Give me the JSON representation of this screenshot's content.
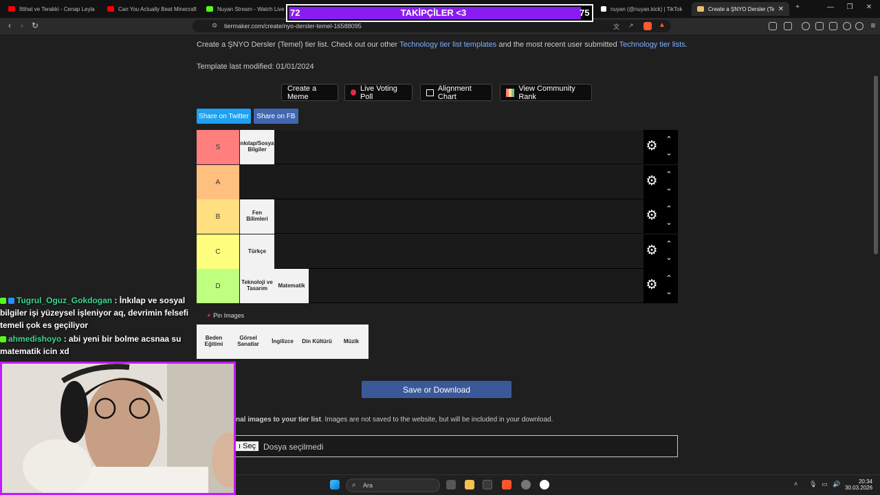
{
  "tabs": [
    {
      "title": "İttihat ve Terakki - Cenap Leyla",
      "color": "#ff0000"
    },
    {
      "title": "Can You Actually Beat Minecraft In",
      "color": "#ff0000"
    },
    {
      "title": "Nuyan Stream - Watch Live on Kick",
      "color": "#53fc18"
    },
    {
      "title": "nuyan (@nuyan.kick) | TikTok",
      "color": "#ffffff"
    },
    {
      "title": "Create a ŞNYO Dersler (Temel)",
      "color": "#e8c06a"
    }
  ],
  "browser": {
    "url": "tiermaker.com/create/nyo-dersler-temel-16588095"
  },
  "page": {
    "intro_prefix": "Create a ŞNYO Dersler (Temel) tier list. Check out our other ",
    "intro_link1": "Technology tier list templates",
    "intro_mid": " and the most recent user submitted ",
    "intro_link2": "Technology tier lists",
    "intro_suffix": ".",
    "modified": "Template last modified: 01/01/2024",
    "buttons": {
      "meme": "Create a Meme",
      "poll": "Live Voting Poll",
      "alignment": "Alignment Chart",
      "community": "View Community Rank"
    },
    "share_twitter": "Share on Twitter",
    "share_fb": "Share on FB",
    "pin_images": "Pin Images",
    "save": "Save or Download",
    "add_images_bold": "nal images to your tier list",
    "add_images_rest": ". Images are not saved to the website, but will be included in your download.",
    "file_btn": "ı Seç",
    "file_status": "Dosya seçilmedi"
  },
  "tiers": [
    {
      "label": "S",
      "color": "#ff7f7f",
      "items": [
        "İnkılap/Sosyal Bilgiler"
      ]
    },
    {
      "label": "A",
      "color": "#ffbf7f",
      "items": []
    },
    {
      "label": "B",
      "color": "#ffdf7f",
      "items": [
        "Fen Bilimleri"
      ]
    },
    {
      "label": "C",
      "color": "#ffff7f",
      "items": [
        "Türkçe"
      ]
    },
    {
      "label": "D",
      "color": "#bfff7f",
      "items": [
        "Teknoloji ve Tasarım",
        "Matematik"
      ]
    }
  ],
  "pool": [
    "Beden Eğitimi",
    "Görsel Sanatlar",
    "İngilizce",
    "Din Kültürü",
    "Müzik"
  ],
  "follower": {
    "left": "72",
    "title": "TAKİPÇİLER <3",
    "right": "75",
    "progress": 0.96
  },
  "chat": [
    {
      "user": "Tugrul_Oguz_Gokdogan",
      "color": "#3dd68c",
      "message": ": İnkılap ve sosyal bilgiler işi yüzeysel işleniyor aq, devrimin felsefi temeli çok es geçiliyor"
    },
    {
      "user": "ahmedishoyo",
      "color": "#3dd68c",
      "message": ": abi yeni bir bolme acsnaa su matematik icin xd"
    }
  ],
  "taskbar": {
    "search": "Ara",
    "time": "20:34",
    "date": "30.03.2026"
  }
}
